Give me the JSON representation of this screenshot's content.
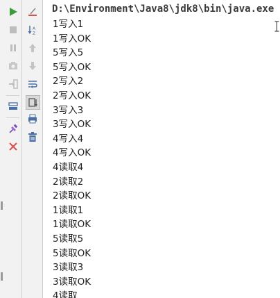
{
  "console": {
    "command": "D:\\Environment\\Java8\\jdk8\\bin\\java.exe",
    "lines": [
      "1写入1",
      "1写入OK",
      "5写入5",
      "5写入OK",
      "2写入2",
      "2写入OK",
      "3写入3",
      "3写入OK",
      "4写入4",
      "4写入OK",
      "4读取4",
      "2读取2",
      "2读取OK",
      "1读取1",
      "1读取OK",
      "5读取5",
      "5读取OK",
      "3读取3",
      "3读取OK",
      "4读取"
    ]
  },
  "toolbar_left": [
    {
      "name": "rerun-icon",
      "color": "#3d9c3a"
    },
    {
      "name": "stop-icon",
      "color": "#bdbdbd"
    },
    {
      "name": "pause-icon",
      "color": "#bdbdbd"
    },
    {
      "name": "camera-icon",
      "color": "#bdbdbd"
    },
    {
      "name": "exit-icon",
      "color": "#bdbdbd"
    },
    {
      "name": "layout-icon",
      "color": "#4a6fa5"
    },
    {
      "name": "pin-icon",
      "color": "#7a4fb0"
    },
    {
      "name": "close-icon",
      "color": "#d9534f"
    }
  ],
  "toolbar_right": [
    {
      "name": "clear-all-icon",
      "color": "#d9534f"
    },
    {
      "name": "sort-icon",
      "color": "#4a6fa5"
    },
    {
      "name": "up-arrow-icon",
      "color": "#c4c4c4"
    },
    {
      "name": "down-arrow-icon",
      "color": "#c4c4c4"
    },
    {
      "name": "soft-wrap-icon",
      "color": "#4a6fa5"
    },
    {
      "name": "scroll-to-end-icon",
      "color": "#5a5a5a"
    },
    {
      "name": "print-icon",
      "color": "#4a6fa5"
    },
    {
      "name": "trash-icon",
      "color": "#4a6fa5"
    }
  ]
}
